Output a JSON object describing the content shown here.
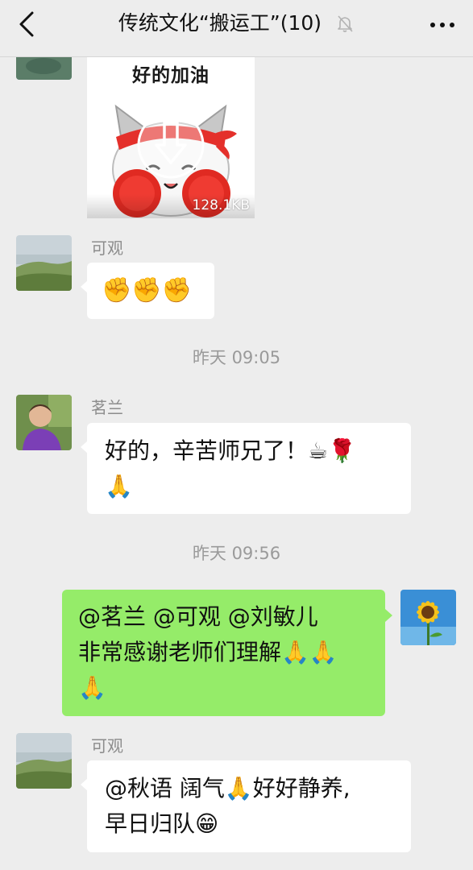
{
  "header": {
    "title": "传统文化“搬运工”(10)",
    "back_icon": "chevron-left-icon",
    "mute_icon": "bell-off-icon",
    "more_icon": "more-horizontal-icon"
  },
  "sticker": {
    "caption": "好的加油",
    "size": "128.1KB",
    "icon": "download-icon"
  },
  "messages": {
    "m1": {
      "sender": "可观",
      "text": "✊✊✊"
    },
    "t1": "昨天 09:05",
    "m2": {
      "sender": "茗兰",
      "line1": "好的，辛苦师兄了！☕🌹",
      "line2": "🙏"
    },
    "t2": "昨天 09:56",
    "m3": {
      "line1": "@茗兰  @可观  @刘敏儿",
      "line2": "非常感谢老师们理解🙏🙏",
      "line3": "🙏"
    },
    "m4": {
      "sender": "可观",
      "line1": "@秋语   阔气🙏好好静养,",
      "line2": "早日归队😁"
    }
  },
  "colors": {
    "background": "#ededed",
    "bubble_in": "#ffffff",
    "bubble_out": "#95ec69",
    "meta_text": "#8c8c8c"
  }
}
